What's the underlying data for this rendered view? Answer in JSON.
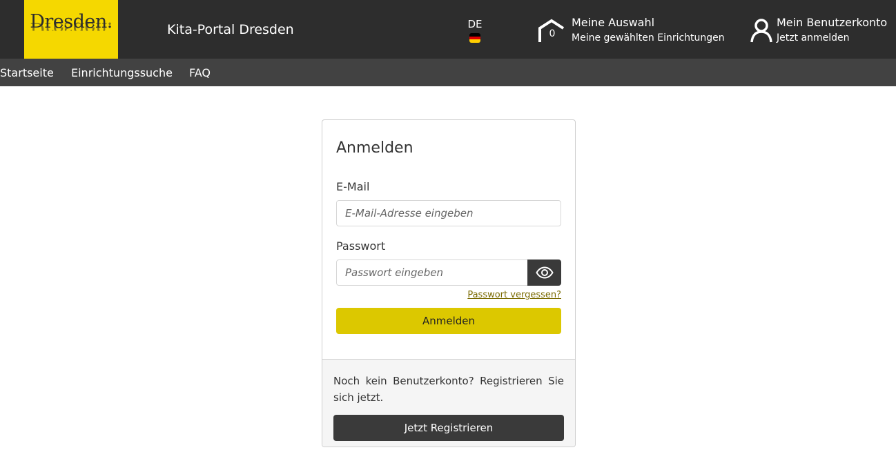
{
  "header": {
    "logo_text": "Dresden.",
    "site_title": "Kita-Portal Dresden",
    "language": {
      "code": "DE",
      "flag_colors": [
        "#000000",
        "#dd0000",
        "#ffce00"
      ]
    },
    "selection": {
      "count": "0",
      "title": "Meine Auswahl",
      "subtitle": "Meine gewählten Einrichtungen"
    },
    "account": {
      "title": "Mein Benutzerkonto",
      "subtitle": "Jetzt anmelden"
    }
  },
  "nav": {
    "items": [
      {
        "label": "Startseite"
      },
      {
        "label": "Einrichtungssuche"
      },
      {
        "label": "FAQ"
      }
    ]
  },
  "login": {
    "heading": "Anmelden",
    "email_label": "E-Mail",
    "email_placeholder": "E-Mail-Adresse eingeben",
    "email_value": "",
    "password_label": "Passwort",
    "password_placeholder": "Passwort eingeben",
    "password_value": "",
    "forgot_link": "Passwort vergessen?",
    "submit_label": "Anmelden"
  },
  "register": {
    "message": "Noch kein Benutzerkonto? Registrieren Sie sich jetzt.",
    "button_label": "Jetzt Registrieren"
  },
  "colors": {
    "brand_yellow": "#f5d800",
    "button_yellow": "#dcc800",
    "header_dark": "#2d2d2d",
    "nav_dark": "#424242"
  }
}
